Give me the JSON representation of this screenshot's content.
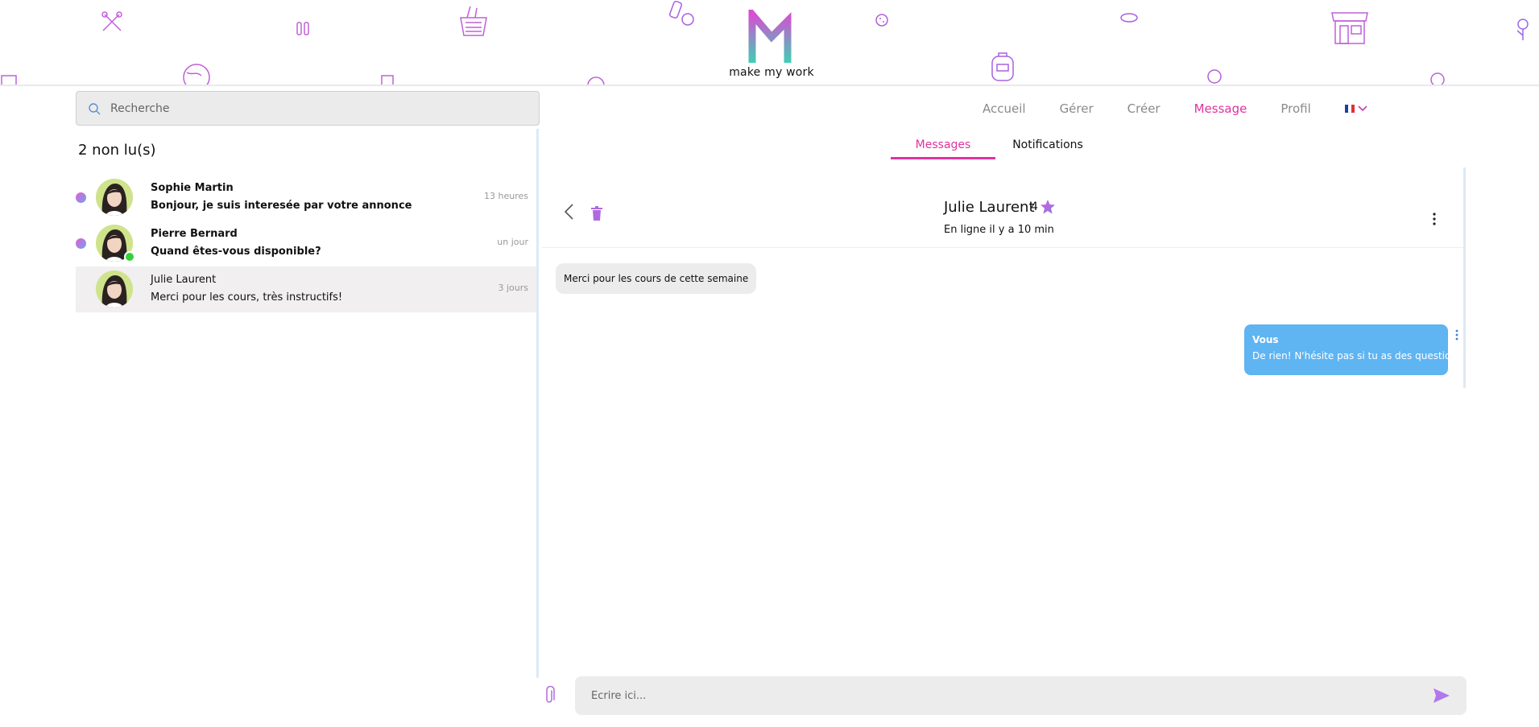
{
  "brand": {
    "name": "make my work"
  },
  "search": {
    "placeholder": "Recherche"
  },
  "nav": {
    "items": [
      "Accueil",
      "Gérer",
      "Créer",
      "Message",
      "Profil"
    ],
    "active": "Message",
    "language_flag": "fr-flag-icon"
  },
  "inbox": {
    "unread_label": "2 non lu(s)",
    "conversations": [
      {
        "name": "Sophie Martin",
        "preview": "Bonjour, je suis interesée par votre annonce",
        "time": "13 heures",
        "unread": true,
        "online": false
      },
      {
        "name": "Pierre Bernard",
        "preview": "Quand êtes-vous disponible?",
        "time": "un jour",
        "unread": true,
        "online": true
      },
      {
        "name": "Julie Laurent",
        "preview": "Merci pour les cours, très instructifs!",
        "time": "3 jours",
        "unread": false,
        "online": false,
        "selected": true
      }
    ]
  },
  "tabs": {
    "messages": "Messages",
    "notifications": "Notifications",
    "active": "Messages"
  },
  "chat": {
    "contact_name": "Julie Laurent",
    "rating": "4",
    "status": "En ligne il y a 10 min",
    "messages": [
      {
        "direction": "in",
        "text": "Merci pour les cours de cette semaine"
      },
      {
        "direction": "out",
        "sender": "Vous",
        "text": "De rien! N'hésite pas si tu as des questions"
      }
    ]
  },
  "composer": {
    "placeholder": "Ecrire ici..."
  },
  "colors": {
    "accent_pink": "#e0339f",
    "out_bubble_blue": "#5fb4f2",
    "online_green": "#34d13b",
    "icon_purple": "#b06ae0"
  }
}
